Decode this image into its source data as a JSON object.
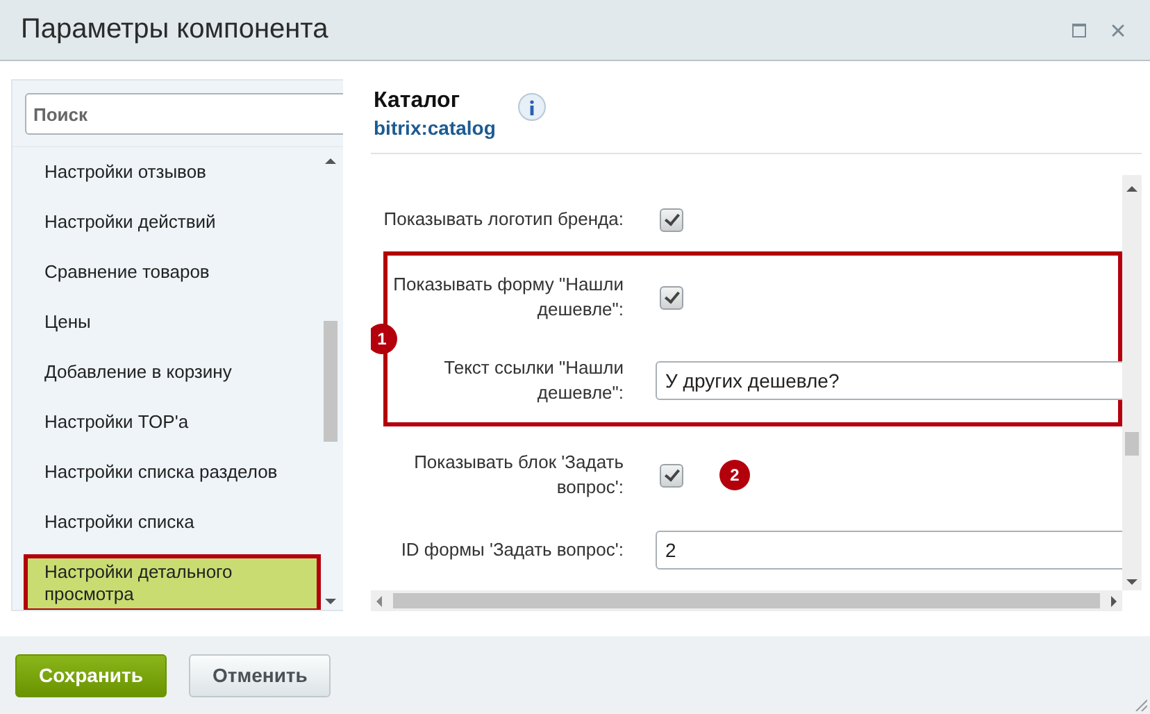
{
  "window": {
    "title": "Параметры компонента"
  },
  "sidebar": {
    "search": {
      "placeholder": "Поиск"
    },
    "items": [
      {
        "label": "Настройки отзывов",
        "selected": false,
        "highlighted": false
      },
      {
        "label": "Настройки действий",
        "selected": false,
        "highlighted": false
      },
      {
        "label": "Сравнение товаров",
        "selected": false,
        "highlighted": false
      },
      {
        "label": "Цены",
        "selected": false,
        "highlighted": false
      },
      {
        "label": "Добавление в корзину",
        "selected": false,
        "highlighted": false
      },
      {
        "label": "Настройки TOP'a",
        "selected": false,
        "highlighted": false
      },
      {
        "label": "Настройки списка разделов",
        "selected": false,
        "highlighted": false
      },
      {
        "label": "Настройки списка",
        "selected": false,
        "highlighted": false
      },
      {
        "label": "Настройки детального просмотра",
        "selected": true,
        "highlighted": true
      }
    ]
  },
  "component": {
    "name": "Каталог",
    "code": "bitrix:catalog"
  },
  "settings": [
    {
      "kind": "checkbox",
      "label": "Показывать логотип бренда:",
      "checked": true
    },
    {
      "kind": "group",
      "callout": "1",
      "rows": [
        {
          "kind": "checkbox",
          "label": "Показывать форму \"Нашли дешевле\":",
          "checked": true
        },
        {
          "kind": "text",
          "label": "Текст ссылки \"Нашли дешевле\":",
          "value": "У других дешевле?"
        }
      ]
    },
    {
      "kind": "checkbox",
      "label": "Показывать блок 'Задать вопрос':",
      "checked": true,
      "callout": "2"
    },
    {
      "kind": "text",
      "label": "ID формы 'Задать вопрос':",
      "value": "2"
    }
  ],
  "buttons": [
    {
      "label": "Сохранить",
      "kind": "primary"
    },
    {
      "label": "Отменить",
      "kind": "secondary"
    }
  ]
}
